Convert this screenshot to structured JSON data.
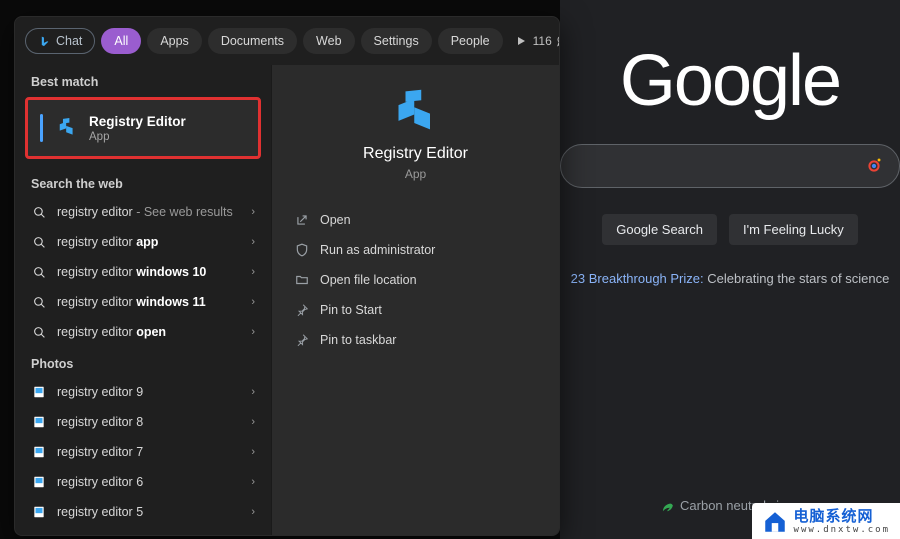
{
  "google": {
    "logo": "Google",
    "searchBtn": "Google Search",
    "luckyBtn": "I'm Feeling Lucky",
    "storyPrefix": "23 Breakthrough Prize:",
    "storyRest": " Celebrating the stars of science",
    "footer": "Carbon neutral since"
  },
  "tabs": {
    "chat": "Chat",
    "all": "All",
    "apps": "Apps",
    "documents": "Documents",
    "web": "Web",
    "settings": "Settings",
    "people": "People",
    "rewards": "116"
  },
  "sections": {
    "bestMatch": "Best match",
    "searchWeb": "Search the web",
    "photos": "Photos"
  },
  "bestMatch": {
    "title": "Registry Editor",
    "subtitle": "App"
  },
  "webResults": [
    {
      "q": "registry editor",
      "extra": " - See web results",
      "bold": ""
    },
    {
      "q": "registry editor ",
      "extra": "",
      "bold": "app"
    },
    {
      "q": "registry editor ",
      "extra": "",
      "bold": "windows 10"
    },
    {
      "q": "registry editor ",
      "extra": "",
      "bold": "windows 11"
    },
    {
      "q": "registry editor ",
      "extra": "",
      "bold": "open"
    }
  ],
  "photos": [
    "registry editor 9",
    "registry editor 8",
    "registry editor 7",
    "registry editor 6",
    "registry editor 5"
  ],
  "preview": {
    "title": "Registry Editor",
    "subtitle": "App",
    "actions": {
      "open": "Open",
      "runAdmin": "Run as administrator",
      "openLoc": "Open file location",
      "pinStart": "Pin to Start",
      "pinTaskbar": "Pin to taskbar"
    }
  },
  "watermark": {
    "cn": "电脑系统网",
    "url": "www.dnxtw.com"
  }
}
